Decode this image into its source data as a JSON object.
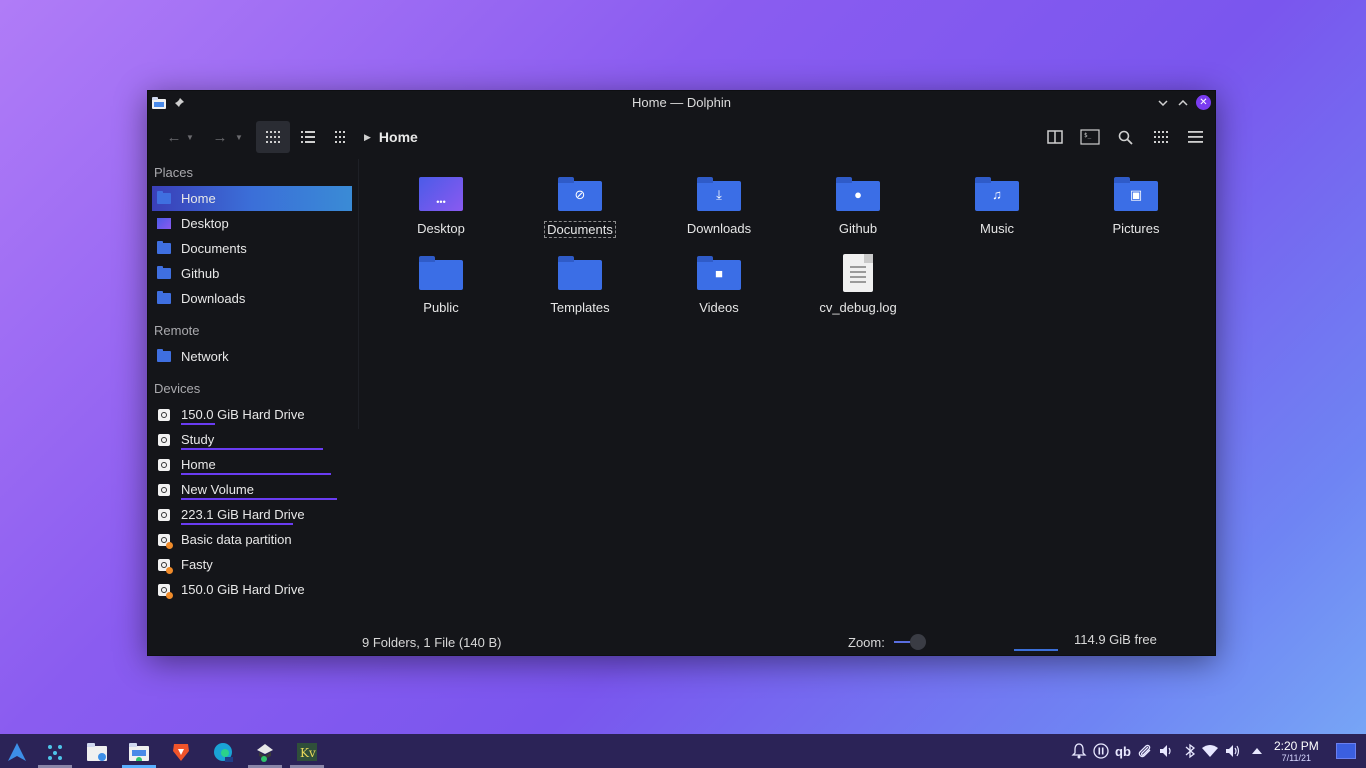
{
  "window": {
    "title": "Home — Dolphin"
  },
  "breadcrumb": {
    "current": "Home"
  },
  "sidebar": {
    "places_title": "Places",
    "places": [
      {
        "label": "Home",
        "icon": "home-folder-icon"
      },
      {
        "label": "Desktop",
        "icon": "desktop-folder-icon"
      },
      {
        "label": "Documents",
        "icon": "documents-folder-icon"
      },
      {
        "label": "Github",
        "icon": "github-folder-icon"
      },
      {
        "label": "Downloads",
        "icon": "downloads-folder-icon"
      }
    ],
    "remote_title": "Remote",
    "remote": [
      {
        "label": "Network",
        "icon": "network-folder-icon"
      }
    ],
    "devices_title": "Devices",
    "devices": [
      {
        "label": "150.0 GiB Hard Drive",
        "usage": 0.17
      },
      {
        "label": "Study",
        "usage": 0.71
      },
      {
        "label": "Home",
        "usage": 0.75
      },
      {
        "label": "New Volume",
        "usage": 0.78
      },
      {
        "label": "223.1 GiB Hard Drive",
        "usage": 0.56
      },
      {
        "label": "Basic data partition",
        "warning": true
      },
      {
        "label": "Fasty",
        "warning": true
      },
      {
        "label": "150.0 GiB Hard Drive",
        "warning": true
      }
    ]
  },
  "files": [
    {
      "label": "Desktop",
      "type": "folder",
      "glyph": "•••"
    },
    {
      "label": "Documents",
      "type": "folder",
      "glyph": "⊘"
    },
    {
      "label": "Downloads",
      "type": "folder",
      "glyph": "⤓"
    },
    {
      "label": "Github",
      "type": "folder",
      "glyph": "●"
    },
    {
      "label": "Music",
      "type": "folder",
      "glyph": "♫"
    },
    {
      "label": "Pictures",
      "type": "folder",
      "glyph": "▣"
    },
    {
      "label": "Public",
      "type": "folder",
      "glyph": ""
    },
    {
      "label": "Templates",
      "type": "folder",
      "glyph": ""
    },
    {
      "label": "Videos",
      "type": "folder",
      "glyph": "■"
    },
    {
      "label": "cv_debug.log",
      "type": "file",
      "glyph": ""
    }
  ],
  "status": {
    "summary": "9 Folders, 1 File (140 B)",
    "zoom_label": "Zoom:",
    "free_space": "114.9 GiB free",
    "free_fraction": 0.25
  },
  "clock": {
    "time": "2:20 PM",
    "date": "7/11/21"
  },
  "colors": {
    "accent": "#3b6ee6",
    "selection_start": "#3a3fb8",
    "selection_end": "#3a8bd6",
    "usage_bar": "#6a3cf2",
    "window_bg": "#141519"
  }
}
